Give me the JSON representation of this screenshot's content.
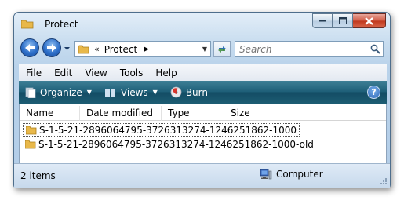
{
  "window": {
    "title": "Protect"
  },
  "navigation": {
    "address_chevron": "«",
    "address_text": "Protect",
    "address_arrow": "▶",
    "search_placeholder": "Search"
  },
  "menu": [
    "File",
    "Edit",
    "View",
    "Tools",
    "Help"
  ],
  "commands": {
    "organize": "Organize",
    "views": "Views",
    "burn": "Burn",
    "help": "?"
  },
  "columns": [
    "Name",
    "Date modified",
    "Type",
    "Size"
  ],
  "files": [
    {
      "name": "S-1-5-21-2896064795-3726313274-1246251862-1000",
      "selected": true
    },
    {
      "name": "S-1-5-21-2896064795-3726313274-1246251862-1000-old",
      "selected": false
    }
  ],
  "status": {
    "item_count": "2 items",
    "zone": "Computer"
  },
  "colors": {
    "command_bar": "#1e5f78",
    "folder": "#e8b84a",
    "close_button": "#c0371c"
  }
}
